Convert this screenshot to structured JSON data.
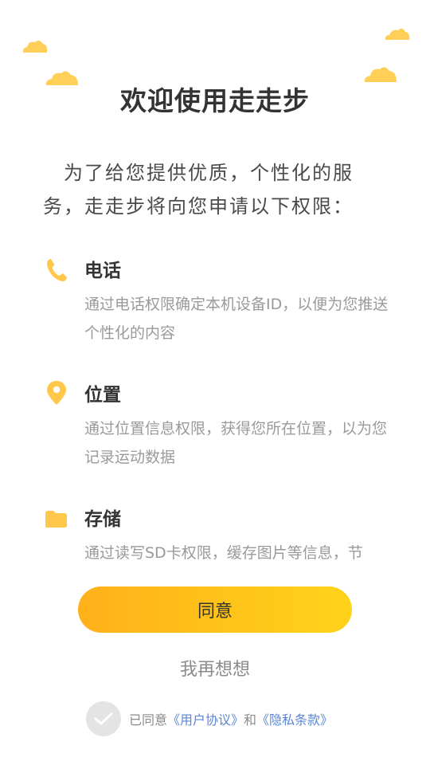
{
  "title": "欢迎使用走走步",
  "intro": "为了给您提供优质，个性化的服务，走走步将向您申请以下权限：",
  "permissions": [
    {
      "title": "电话",
      "desc": "通过电话权限确定本机设备ID，以便为您推送个性化的内容",
      "icon": "phone-icon"
    },
    {
      "title": "位置",
      "desc": "通过位置信息权限，获得您所在位置，以为您记录运动数据",
      "icon": "location-pin-icon"
    },
    {
      "title": "存储",
      "desc": "通过读写SD卡权限，缓存图片等信息，节",
      "icon": "folder-icon"
    }
  ],
  "agree_label": "同意",
  "rethink_label": "我再想想",
  "consent": {
    "prefix": "已同意",
    "user_agreement": "《用户协议》",
    "and": "和",
    "privacy": "《隐私条款》"
  },
  "colors": {
    "accent": "#ffc21a",
    "icon": "#ffc84a",
    "link": "#5b86d6",
    "cloud": "#ffcf57"
  }
}
